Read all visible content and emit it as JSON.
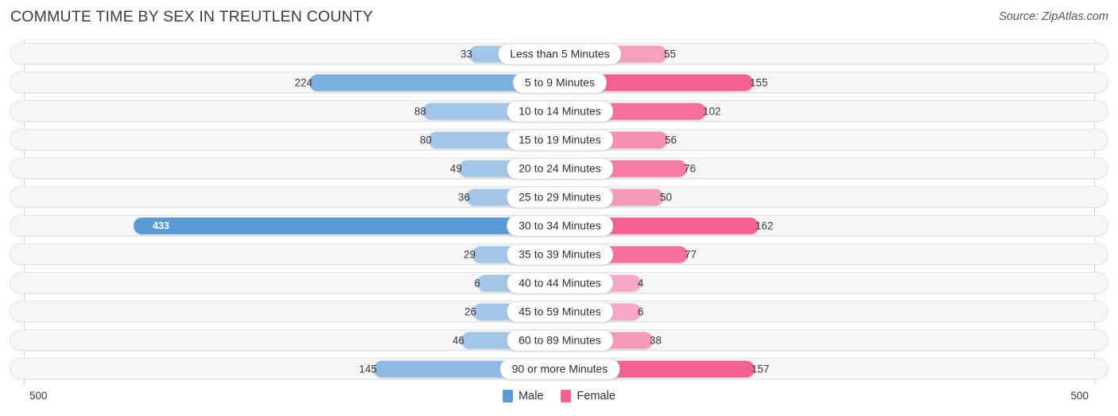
{
  "header": {
    "title": "COMMUTE TIME BY SEX IN TREUTLEN COUNTY",
    "source": "Source: ZipAtlas.com"
  },
  "legend": {
    "male_label": "Male",
    "female_label": "Female",
    "male_color": "#5b9bd5",
    "female_color": "#f4608f"
  },
  "axis": {
    "left_tick": "500",
    "right_tick": "500",
    "max": 500
  },
  "chart_data": {
    "type": "bar",
    "orientation": "horizontal",
    "layout": "diverging-bidirectional",
    "title": "COMMUTE TIME BY SEX IN TREUTLEN COUNTY",
    "xlabel": "",
    "ylabel": "",
    "xlim": [
      500,
      500
    ],
    "grid": false,
    "legend_position": "bottom-center",
    "categories": [
      "Less than 5 Minutes",
      "5 to 9 Minutes",
      "10 to 14 Minutes",
      "15 to 19 Minutes",
      "20 to 24 Minutes",
      "25 to 29 Minutes",
      "30 to 34 Minutes",
      "35 to 39 Minutes",
      "40 to 44 Minutes",
      "45 to 59 Minutes",
      "60 to 89 Minutes",
      "90 or more Minutes"
    ],
    "series": [
      {
        "name": "Male",
        "color": "#5b9bd5",
        "values": [
          33,
          224,
          88,
          80,
          49,
          36,
          433,
          29,
          6,
          26,
          46,
          145
        ]
      },
      {
        "name": "Female",
        "color": "#f4608f",
        "values": [
          55,
          155,
          102,
          56,
          76,
          50,
          162,
          77,
          4,
          6,
          38,
          157
        ]
      }
    ]
  },
  "rows": [
    {
      "category": "Less than 5 Minutes",
      "male": "33",
      "female": "55",
      "male_w": 100,
      "female_w": 123,
      "male_color": "#a3c6e8",
      "female_color": "#f4a0bf",
      "male_inside": false
    },
    {
      "category": "5 to 9 Minutes",
      "male": "224",
      "female": "155",
      "male_w": 301,
      "female_w": 231,
      "male_color": "#7db0de",
      "female_color": "#f4608f",
      "male_inside": false
    },
    {
      "category": "10 to 14 Minutes",
      "male": "88",
      "female": "102",
      "male_w": 158,
      "female_w": 172,
      "male_color": "#a3c6e8",
      "female_color": "#f46f9c",
      "male_inside": false
    },
    {
      "category": "15 to 19 Minutes",
      "male": "80",
      "female": "56",
      "male_w": 151,
      "female_w": 124,
      "male_color": "#a3c6e8",
      "female_color": "#f48fb4",
      "male_inside": false
    },
    {
      "category": "20 to 24 Minutes",
      "male": "49",
      "female": "76",
      "male_w": 113,
      "female_w": 148,
      "male_color": "#a3c6e8",
      "female_color": "#f47ca6",
      "male_inside": false
    },
    {
      "category": "25 to 29 Minutes",
      "male": "36",
      "female": "50",
      "male_w": 103,
      "female_w": 118,
      "male_color": "#a3c6e8",
      "female_color": "#f49bbc",
      "male_inside": false
    },
    {
      "category": "30 to 34 Minutes",
      "male": "433",
      "female": "162",
      "male_w": 522,
      "female_w": 238,
      "male_color": "#5b9bd5",
      "female_color": "#f4608f",
      "male_inside": true
    },
    {
      "category": "35 to 39 Minutes",
      "male": "29",
      "female": "77",
      "male_w": 96,
      "female_w": 149,
      "male_color": "#a3c6e8",
      "female_color": "#f4709c",
      "male_inside": false
    },
    {
      "category": "40 to 44 Minutes",
      "male": "6",
      "female": "4",
      "male_w": 90,
      "female_w": 90,
      "male_color": "#a3c6e8",
      "female_color": "#f7a8c6",
      "male_inside": false
    },
    {
      "category": "45 to 59 Minutes",
      "male": "26",
      "female": "6",
      "male_w": 95,
      "female_w": 90,
      "male_color": "#a3c6e8",
      "female_color": "#f7a8c6",
      "male_inside": false
    },
    {
      "category": "60 to 89 Minutes",
      "male": "46",
      "female": "38",
      "male_w": 110,
      "female_w": 105,
      "male_color": "#a3c6e8",
      "female_color": "#f49bbc",
      "male_inside": false
    },
    {
      "category": "90 or more Minutes",
      "male": "145",
      "female": "157",
      "male_w": 220,
      "female_w": 233,
      "male_color": "#8eb9e3",
      "female_color": "#f4608f",
      "male_inside": false
    }
  ]
}
